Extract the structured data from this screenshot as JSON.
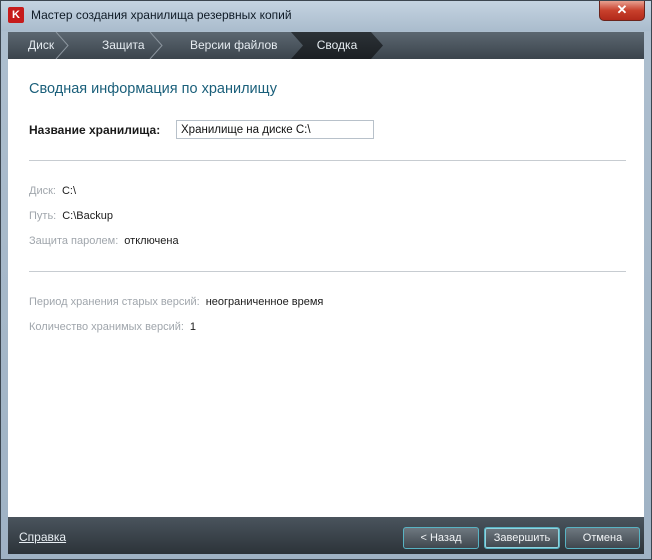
{
  "window": {
    "title": "Мастер создания хранилища резервных копий",
    "app_icon_label": "K",
    "close_label": "✕"
  },
  "tabs": [
    {
      "label": "Диск",
      "active": false
    },
    {
      "label": "Защита",
      "active": false
    },
    {
      "label": "Версии файлов",
      "active": false
    },
    {
      "label": "Сводка",
      "active": true
    }
  ],
  "summary": {
    "heading": "Сводная информация по хранилищу",
    "name_label": "Название хранилища:",
    "name_value": "Хранилище на диске C:\\",
    "disk_label": "Диск:",
    "disk_value": "C:\\",
    "path_label": "Путь:",
    "path_value": "C:\\Backup",
    "password_label": "Защита паролем:",
    "password_value": "отключена",
    "retention_label": "Период хранения старых версий:",
    "retention_value": "неограниченное время",
    "versions_label": "Количество хранимых версий:",
    "versions_value": "1"
  },
  "footer": {
    "help_label": "Справка",
    "back_label": "< Назад",
    "finish_label": "Завершить",
    "cancel_label": "Отмена"
  },
  "colors": {
    "accent_heading": "#1a5f7a",
    "button_border": "#58b3c3",
    "close_button": "#c8402c"
  }
}
